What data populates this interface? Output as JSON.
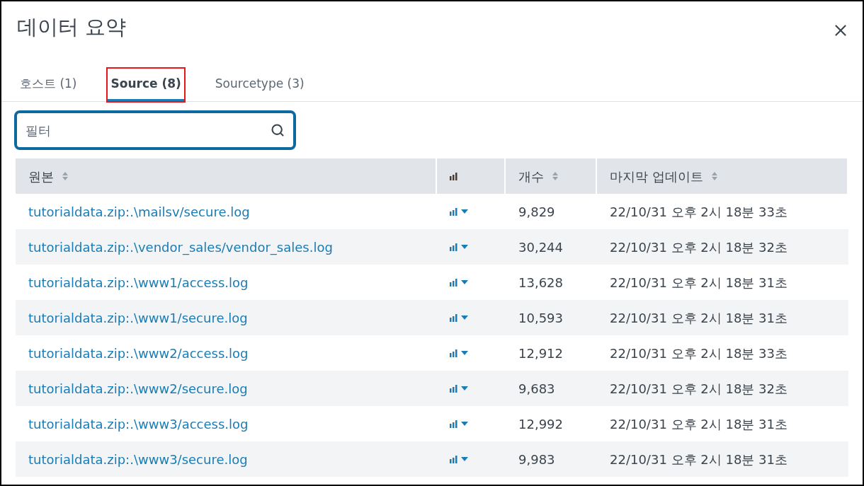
{
  "title": "데이터 요약",
  "tabs": [
    {
      "label": "호스트 (1)",
      "selected": false,
      "highlighted": false
    },
    {
      "label": "Source (8)",
      "selected": true,
      "highlighted": true
    },
    {
      "label": "Sourcetype (3)",
      "selected": false,
      "highlighted": false
    }
  ],
  "filter": {
    "placeholder": "필터"
  },
  "table": {
    "columns": [
      {
        "label": "원본",
        "kind": "sortable"
      },
      {
        "kind": "chart"
      },
      {
        "label": "개수",
        "kind": "sortable"
      },
      {
        "label": "마지막 업데이트",
        "kind": "sortable"
      }
    ],
    "rows": [
      {
        "source": "tutorialdata.zip:.\\mailsv/secure.log",
        "count": "9,829",
        "updated": "22/10/31 오후 2시 18분 33초"
      },
      {
        "source": "tutorialdata.zip:.\\vendor_sales/vendor_sales.log",
        "count": "30,244",
        "updated": "22/10/31 오후 2시 18분 32초"
      },
      {
        "source": "tutorialdata.zip:.\\www1/access.log",
        "count": "13,628",
        "updated": "22/10/31 오후 2시 18분 31초"
      },
      {
        "source": "tutorialdata.zip:.\\www1/secure.log",
        "count": "10,593",
        "updated": "22/10/31 오후 2시 18분 31초"
      },
      {
        "source": "tutorialdata.zip:.\\www2/access.log",
        "count": "12,912",
        "updated": "22/10/31 오후 2시 18분 33초"
      },
      {
        "source": "tutorialdata.zip:.\\www2/secure.log",
        "count": "9,683",
        "updated": "22/10/31 오후 2시 18분 32초"
      },
      {
        "source": "tutorialdata.zip:.\\www3/access.log",
        "count": "12,992",
        "updated": "22/10/31 오후 2시 18분 31초"
      },
      {
        "source": "tutorialdata.zip:.\\www3/secure.log",
        "count": "9,983",
        "updated": "22/10/31 오후 2시 18분 31초"
      }
    ]
  }
}
